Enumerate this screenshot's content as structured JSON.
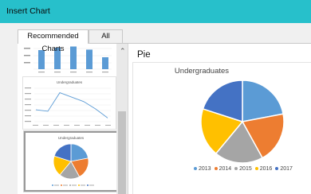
{
  "window": {
    "title": "Insert Chart"
  },
  "tabs": [
    {
      "label": "Recommended Charts",
      "active": true
    },
    {
      "label": "All Charts",
      "active": false
    }
  ],
  "thumbnails": {
    "bar": {
      "values": [
        80,
        90,
        95,
        82,
        50
      ]
    },
    "line": {
      "title": "Undergraduates",
      "values": [
        1600,
        1400,
        3900,
        3300,
        2700,
        1700,
        500
      ]
    },
    "pie": {
      "title": "Undergraduates"
    }
  },
  "preview": {
    "heading": "Pie",
    "chart_data": {
      "type": "pie",
      "title": "Undergraduates",
      "series": [
        {
          "values": [
            22,
            20,
            19,
            19,
            20
          ]
        }
      ],
      "categories": [
        "2013",
        "2014",
        "2015",
        "2016",
        "2017"
      ],
      "colors": [
        "#5b9bd5",
        "#ed7d31",
        "#a5a5a5",
        "#ffc000",
        "#4472c4"
      ],
      "legend": "bottom"
    }
  }
}
